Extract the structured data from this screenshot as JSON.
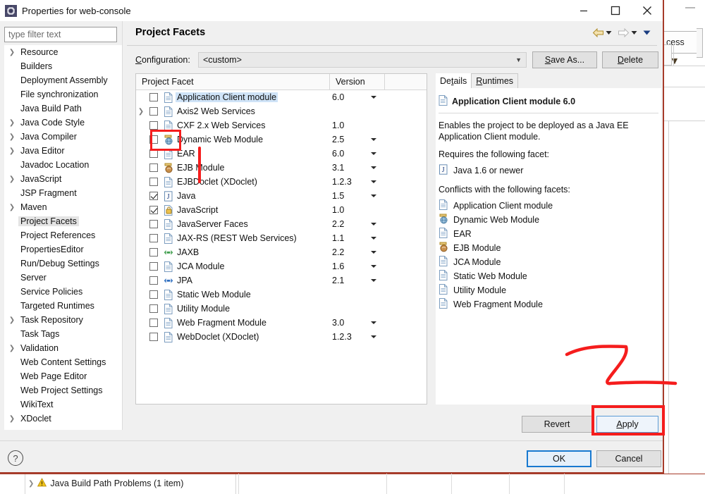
{
  "window": {
    "title": "Properties for web-console",
    "icon": "eclipse-properties-icon",
    "minimize_label": "minimize",
    "maximize_label": "maximize",
    "close_label": "close"
  },
  "sidebar": {
    "filter_placeholder": "type filter text",
    "items": [
      {
        "label": "Resource",
        "expandable": true,
        "selected": false
      },
      {
        "label": "Builders",
        "expandable": false,
        "selected": false
      },
      {
        "label": "Deployment Assembly",
        "expandable": false,
        "selected": false
      },
      {
        "label": "File synchronization",
        "expandable": false,
        "selected": false
      },
      {
        "label": "Java Build Path",
        "expandable": false,
        "selected": false
      },
      {
        "label": "Java Code Style",
        "expandable": true,
        "selected": false
      },
      {
        "label": "Java Compiler",
        "expandable": true,
        "selected": false
      },
      {
        "label": "Java Editor",
        "expandable": true,
        "selected": false
      },
      {
        "label": "Javadoc Location",
        "expandable": false,
        "selected": false
      },
      {
        "label": "JavaScript",
        "expandable": true,
        "selected": false
      },
      {
        "label": "JSP Fragment",
        "expandable": false,
        "selected": false
      },
      {
        "label": "Maven",
        "expandable": true,
        "selected": false
      },
      {
        "label": "Project Facets",
        "expandable": false,
        "selected": true
      },
      {
        "label": "Project References",
        "expandable": false,
        "selected": false
      },
      {
        "label": "PropertiesEditor",
        "expandable": false,
        "selected": false
      },
      {
        "label": "Run/Debug Settings",
        "expandable": false,
        "selected": false
      },
      {
        "label": "Server",
        "expandable": false,
        "selected": false
      },
      {
        "label": "Service Policies",
        "expandable": false,
        "selected": false
      },
      {
        "label": "Targeted Runtimes",
        "expandable": false,
        "selected": false
      },
      {
        "label": "Task Repository",
        "expandable": true,
        "selected": false
      },
      {
        "label": "Task Tags",
        "expandable": false,
        "selected": false
      },
      {
        "label": "Validation",
        "expandable": true,
        "selected": false
      },
      {
        "label": "Web Content Settings",
        "expandable": false,
        "selected": false
      },
      {
        "label": "Web Page Editor",
        "expandable": false,
        "selected": false
      },
      {
        "label": "Web Project Settings",
        "expandable": false,
        "selected": false
      },
      {
        "label": "WikiText",
        "expandable": false,
        "selected": false
      },
      {
        "label": "XDoclet",
        "expandable": true,
        "selected": false
      }
    ]
  },
  "page": {
    "title": "Project Facets",
    "nav": {
      "back_icon": "back-arrow-icon",
      "back_menu_icon": "chevron-down-icon",
      "forward_icon": "forward-arrow-icon",
      "forward_menu_icon": "chevron-down-icon",
      "more_icon": "chevron-down-icon"
    },
    "configuration": {
      "label": "Configuration:",
      "label_mnemonic": "C",
      "value": "<custom>",
      "chevron_icon": "chevron-down-icon"
    },
    "save_as_button": "Save As...",
    "save_as_mnemonic": "S",
    "delete_button": "Delete",
    "delete_mnemonic": "D"
  },
  "facets": {
    "columns": [
      "Project Facet",
      "Version"
    ],
    "rows": [
      {
        "name": "Application Client module",
        "version": "6.0",
        "checked": false,
        "selected": true,
        "expandable": false,
        "dropdown": true,
        "icon": "document-icon"
      },
      {
        "name": "Axis2 Web Services",
        "version": "",
        "checked": false,
        "selected": false,
        "expandable": true,
        "dropdown": false,
        "icon": "document-icon"
      },
      {
        "name": "CXF 2.x Web Services",
        "version": "1.0",
        "checked": false,
        "selected": false,
        "expandable": false,
        "dropdown": false,
        "icon": "document-icon"
      },
      {
        "name": "Dynamic Web Module",
        "version": "2.5",
        "checked": false,
        "selected": false,
        "expandable": false,
        "dropdown": true,
        "icon": "web-module-icon"
      },
      {
        "name": "EAR",
        "version": "6.0",
        "checked": false,
        "selected": false,
        "expandable": false,
        "dropdown": true,
        "icon": "document-icon"
      },
      {
        "name": "EJB Module",
        "version": "3.1",
        "checked": false,
        "selected": false,
        "expandable": false,
        "dropdown": true,
        "icon": "ejb-module-icon"
      },
      {
        "name": "EJBDoclet (XDoclet)",
        "version": "1.2.3",
        "checked": false,
        "selected": false,
        "expandable": false,
        "dropdown": true,
        "icon": "document-icon"
      },
      {
        "name": "Java",
        "version": "1.5",
        "checked": true,
        "selected": false,
        "expandable": false,
        "dropdown": true,
        "icon": "java-icon"
      },
      {
        "name": "JavaScript",
        "version": "1.0",
        "checked": true,
        "selected": false,
        "expandable": false,
        "dropdown": false,
        "icon": "javascript-icon"
      },
      {
        "name": "JavaServer Faces",
        "version": "2.2",
        "checked": false,
        "selected": false,
        "expandable": false,
        "dropdown": true,
        "icon": "document-icon"
      },
      {
        "name": "JAX-RS (REST Web Services)",
        "version": "1.1",
        "checked": false,
        "selected": false,
        "expandable": false,
        "dropdown": true,
        "icon": "document-icon"
      },
      {
        "name": "JAXB",
        "version": "2.2",
        "checked": false,
        "selected": false,
        "expandable": false,
        "dropdown": true,
        "icon": "jaxb-icon"
      },
      {
        "name": "JCA Module",
        "version": "1.6",
        "checked": false,
        "selected": false,
        "expandable": false,
        "dropdown": true,
        "icon": "document-icon"
      },
      {
        "name": "JPA",
        "version": "2.1",
        "checked": false,
        "selected": false,
        "expandable": false,
        "dropdown": true,
        "icon": "jpa-icon"
      },
      {
        "name": "Static Web Module",
        "version": "",
        "checked": false,
        "selected": false,
        "expandable": false,
        "dropdown": false,
        "icon": "document-icon"
      },
      {
        "name": "Utility Module",
        "version": "",
        "checked": false,
        "selected": false,
        "expandable": false,
        "dropdown": false,
        "icon": "document-icon"
      },
      {
        "name": "Web Fragment Module",
        "version": "3.0",
        "checked": false,
        "selected": false,
        "expandable": false,
        "dropdown": true,
        "icon": "document-icon"
      },
      {
        "name": "WebDoclet (XDoclet)",
        "version": "1.2.3",
        "checked": false,
        "selected": false,
        "expandable": false,
        "dropdown": true,
        "icon": "document-icon"
      }
    ]
  },
  "details": {
    "tabs": [
      {
        "label": "Details",
        "mnemonic": "t",
        "active": true
      },
      {
        "label": "Runtimes",
        "mnemonic": "R",
        "active": false
      }
    ],
    "heading": "Application Client module 6.0",
    "heading_icon": "document-icon",
    "description": "Enables the project to be deployed as a Java EE Application Client module.",
    "requires_label": "Requires the following facet:",
    "requires": [
      {
        "label": "Java 1.6 or newer",
        "icon": "java-icon"
      }
    ],
    "conflicts_label": "Conflicts with the following facets:",
    "conflicts": [
      {
        "label": "Application Client module",
        "icon": "document-icon"
      },
      {
        "label": "Dynamic Web Module",
        "icon": "web-module-icon"
      },
      {
        "label": "EAR",
        "icon": "document-icon"
      },
      {
        "label": "EJB Module",
        "icon": "ejb-module-icon"
      },
      {
        "label": "JCA Module",
        "icon": "document-icon"
      },
      {
        "label": "Static Web Module",
        "icon": "document-icon"
      },
      {
        "label": "Utility Module",
        "icon": "document-icon"
      },
      {
        "label": "Web Fragment Module",
        "icon": "document-icon"
      }
    ]
  },
  "buttons": {
    "revert": "Revert",
    "apply": "Apply",
    "apply_mnemonic": "A",
    "ok": "OK",
    "cancel": "Cancel",
    "help_icon": "help-question-icon"
  },
  "annotations": {
    "color": "#f51d1d",
    "checkbox_highlight": "red-rectangle-around-dynamic-web-module-checkbox",
    "arrow": "red-down-arrow",
    "apply_highlight": "red-rectangle-around-apply-button",
    "step_two": "2"
  },
  "background": {
    "tab_label": "cess",
    "problem_text": "Java Build Path Problems (1 item)",
    "problem_icon": "warning-icon",
    "problem_expand_icon": "chevron-right-icon"
  }
}
